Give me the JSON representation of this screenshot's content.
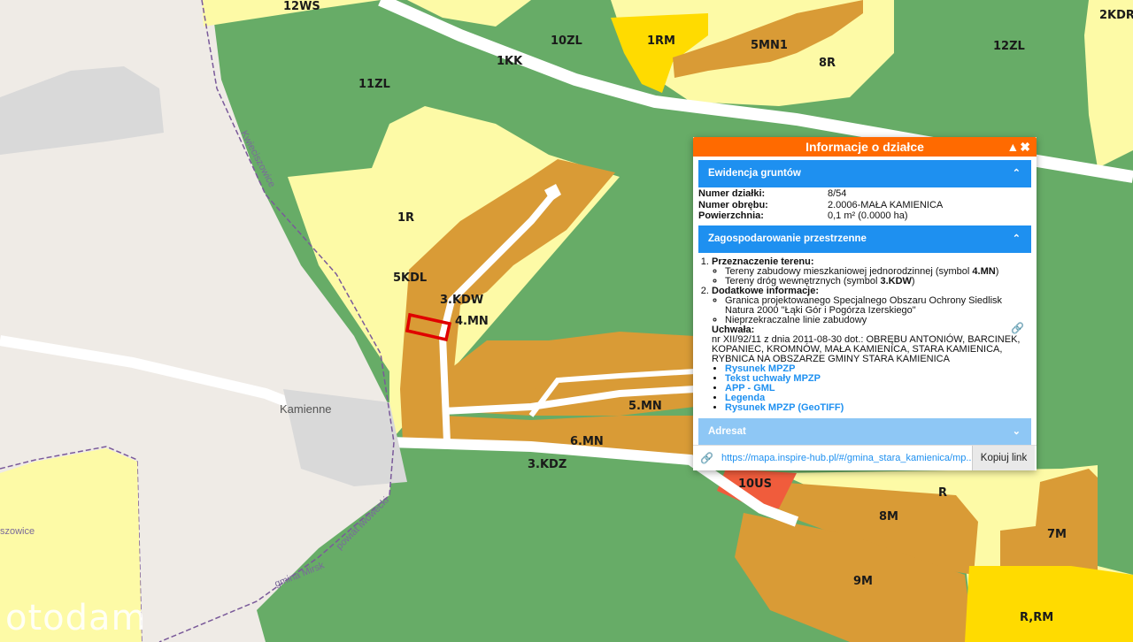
{
  "map": {
    "zone_labels": {
      "z12ws": "12WS",
      "z10zl": "10ZL",
      "z1rm": "1RM",
      "z5mn1": "5MN1",
      "z12zl": "12ZL",
      "z2kdr": "2KDR",
      "z1kk": "1KK",
      "z8r_top": "8R",
      "z11zl": "11ZL",
      "z1r": "1R",
      "z5kdl": "5KDL",
      "z3kdw": "3.KDW",
      "z4mn": "4.MN",
      "z5mn": "5.MN",
      "z6mn": "6.MN",
      "z3kdz": "3.KDZ",
      "z10us": "10US",
      "zr": "R",
      "z8m": "8M",
      "z7m": "7M",
      "z9m": "9M",
      "zrrm": "R,RM"
    },
    "place_labels": {
      "kamienne": "Kamienne",
      "kwieciszowice": "Kwieciszowice",
      "kwieciszowice_cut": "szowice",
      "gmina": "gmina Mirsk",
      "powiat": "powiat lwówecki"
    },
    "colors": {
      "forest": "#67ac67",
      "agri": "#fdfaa6",
      "built": "#d99b36",
      "orange": "#ffdb00",
      "service": "#f05c3c",
      "background": "#efebe6",
      "parcel": "#e00000"
    }
  },
  "panel": {
    "title": "Informacje o działce",
    "ewidencja": {
      "title": "Ewidencja gruntów",
      "rows": [
        {
          "key": "Numer działki:",
          "value": "8/54"
        },
        {
          "key": "Numer obrębu:",
          "value": "2.0006-MAŁA KAMIENICA"
        },
        {
          "key": "Powierzchnia:",
          "value": "0,1 m² (0.0000 ha)"
        }
      ]
    },
    "zagospodarowanie": {
      "title": "Zagospodarowanie przestrzenne",
      "przeznaczenie_title": "Przeznaczenie terenu:",
      "przeznaczenie_1": "Tereny zabudowy mieszkaniowej jednorodzinnej (symbol ",
      "przeznaczenie_1_symbol": "4.MN",
      "przeznaczenie_1_end": ")",
      "przeznaczenie_2": "Tereny dróg wewnętrznych (symbol ",
      "przeznaczenie_2_symbol": "3.KDW",
      "przeznaczenie_2_end": ")",
      "dodatkowe_title": "Dodatkowe informacje:",
      "dodatkowe_1": "Granica projektowanego Specjalnego Obszaru Ochrony Siedlisk Natura 2000 \"Łąki Gór i Pogórza Izerskiego\"",
      "dodatkowe_2": "Nieprzekraczalne linie zabudowy",
      "uchwala_title": "Uchwała:",
      "uchwala_text": "nr XII/92/11 z dnia 2011-08-30 dot.: OBRĘBU ANTONIÓW, BARCINEK, KOPANIEC, KROMNÓW, MAŁA KAMIENICA, STARA KAMIENICA, RYBNICA NA OBSZARZE GMINY STARA KAMIENICA",
      "links": [
        "Rysunek MPZP",
        "Tekst uchwały MPZP",
        "APP - GML",
        "Legenda",
        "Rysunek MPZP (GeoTIFF)"
      ]
    },
    "adresat": {
      "title": "Adresat"
    },
    "url": "https://mapa.inspire-hub.pl/#/gmina_stara_kamienica/mp...",
    "copy_label": "Kopiuj link"
  },
  "watermark": "otodam"
}
